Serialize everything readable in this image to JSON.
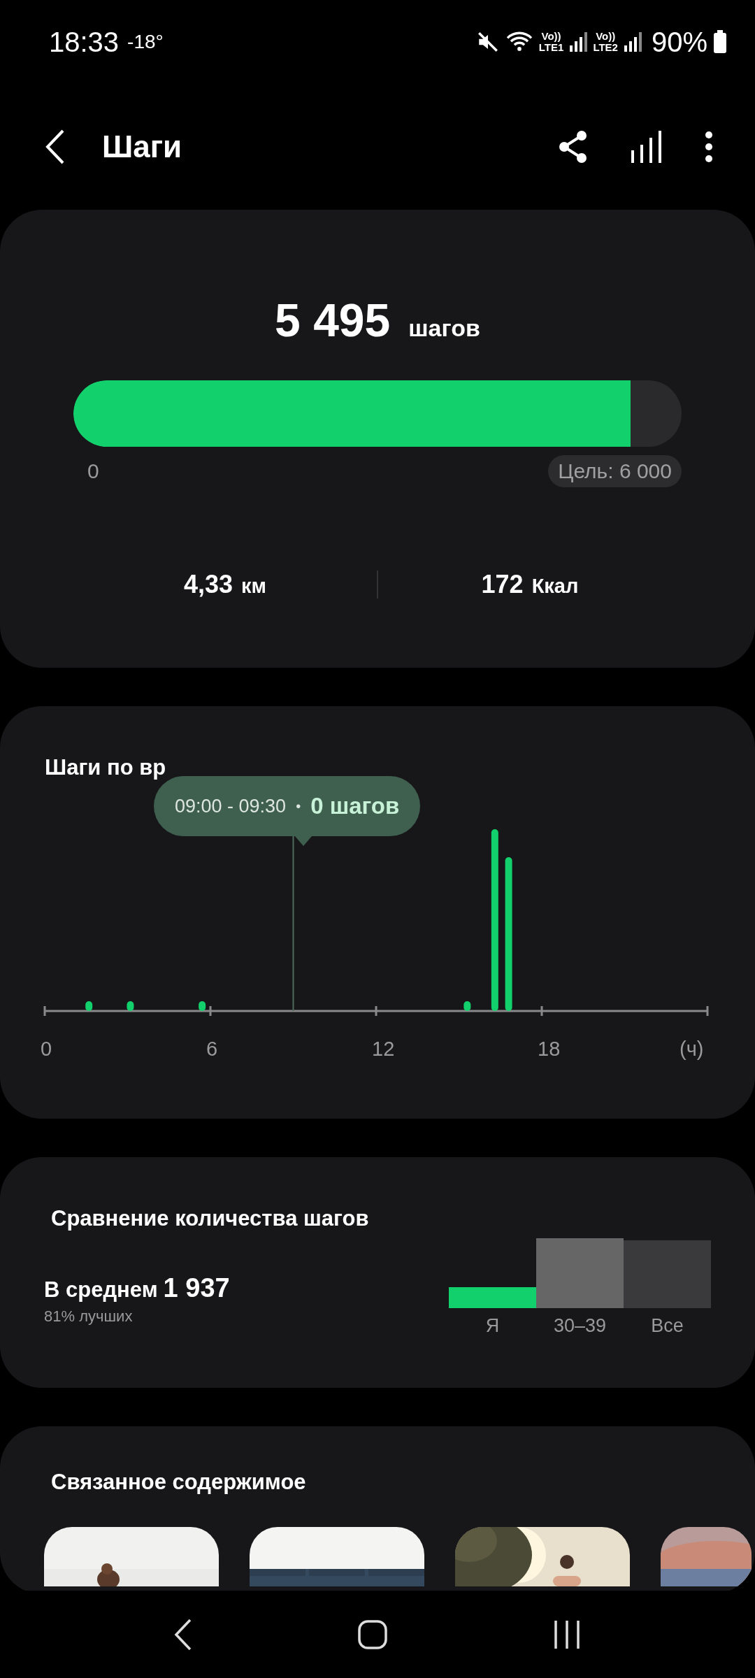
{
  "status_bar": {
    "time": "18:33",
    "temperature": "-18°",
    "sims": [
      {
        "top": "Vo))",
        "bottom": "LTE1"
      },
      {
        "top": "Vo))",
        "bottom": "LTE2"
      }
    ],
    "battery": "90%"
  },
  "header": {
    "title": "Шаги"
  },
  "summary": {
    "value": "5 495",
    "unit": "шагов",
    "progress": {
      "level": 0.916,
      "start": "0",
      "goal": "Цель: 6 000"
    },
    "stats": [
      {
        "value": "4,33",
        "unit": "км"
      },
      {
        "value": "172",
        "unit": "Ккал"
      }
    ]
  },
  "hourly": {
    "title": "Шаги по вр",
    "tooltip": {
      "time": "09:00 - 09:30",
      "separator": "•",
      "value": "0 шагов"
    },
    "axis_labels": [
      "0",
      "6",
      "12",
      "18",
      "(ч)"
    ]
  },
  "comparison": {
    "title": "Сравнение количества шагов",
    "average_label": "В среднем",
    "average_value": "1 937",
    "rank": "81% лучших",
    "groups": [
      {
        "label": "Я",
        "kind": "me"
      },
      {
        "label": "30–39",
        "kind": "age"
      },
      {
        "label": "Все",
        "kind": "all"
      }
    ]
  },
  "related": {
    "title": "Связанное содержимое"
  }
}
